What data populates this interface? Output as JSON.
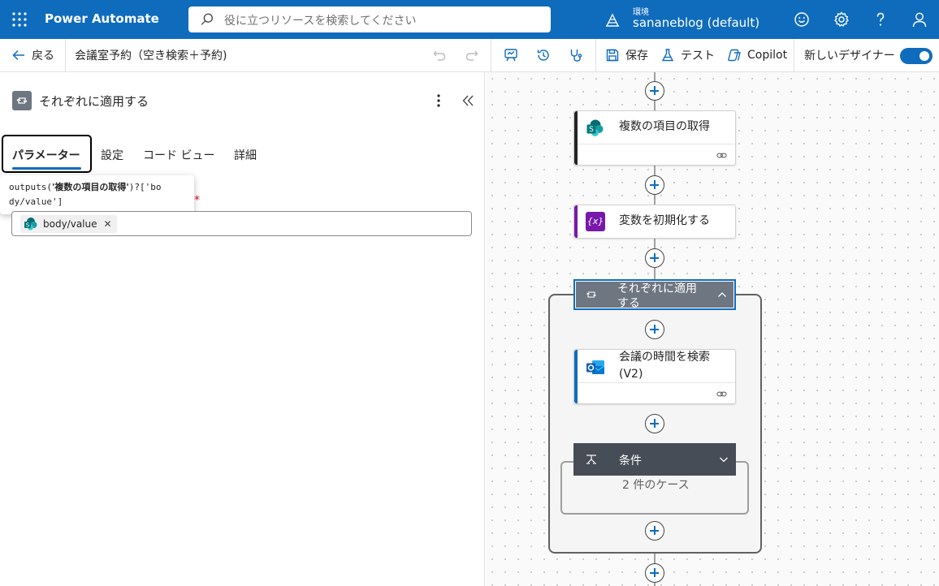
{
  "header": {
    "brand": "Power Automate",
    "search_placeholder": "役に立つリソースを検索してください",
    "env_label": "環境",
    "env_name": "sananeblog (default)"
  },
  "command_bar": {
    "back": "戻る",
    "flow_name": "会議室予約（空き検索＋予約)",
    "save": "保存",
    "test": "テスト",
    "copilot": "Copilot",
    "new_designer": "新しいデザイナー",
    "new_designer_on": true
  },
  "panel": {
    "title": "それぞれに適用する",
    "tabs": [
      {
        "label": "パラメーター",
        "active": true
      },
      {
        "label": "設定",
        "active": false
      },
      {
        "label": "コード ビュー",
        "active": false
      },
      {
        "label": "詳細",
        "active": false
      }
    ],
    "tooltip_prefix": "outputs(",
    "tooltip_bold": "'複数の項目の取得'",
    "tooltip_suffix": ")?['bo",
    "tooltip_line2": "dy/value']",
    "required_mark": "*",
    "token_label": "body/value",
    "token_remove": "✕"
  },
  "canvas": {
    "actions": [
      {
        "id": "get-items",
        "title": "複数の項目の取得",
        "color": "#242424"
      },
      {
        "id": "init-variable",
        "title": "変数を初期化する",
        "color": "#7719aa"
      },
      {
        "id": "find-meeting-times",
        "title": "会議の時間を検索 (V2)",
        "color": "#0f6cbd"
      }
    ],
    "loop": {
      "title": "それぞれに適用する"
    },
    "condition": {
      "title": "条件",
      "cases": "2 件のケース"
    }
  },
  "colors": {
    "primary": "#0f6cbd",
    "loop_header": "#6e7681",
    "condition_header": "#474d57",
    "variable_purple": "#7719aa"
  }
}
